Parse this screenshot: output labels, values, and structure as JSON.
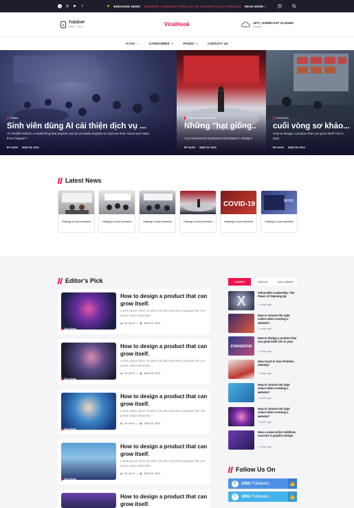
{
  "topbar": {
    "social": [
      "f",
      "◎",
      "▶",
      "t"
    ],
    "breaking_label": "BREAKING NEWS",
    "headline": "JENNIFER LAWRENCE TOPS LIST OF HIGHEST-PAID ACTRESSES",
    "read_more": "READ MORE ›"
  },
  "header": {
    "day": "TUESDAY",
    "date": "May 7, 2024",
    "cal_day": "5",
    "logo": "ViralHook",
    "weather_main": "10ºC, OVERCAST CLOUDS",
    "weather_loc": "Canada"
  },
  "nav": [
    {
      "label": "HOME"
    },
    {
      "label": "CATEGORIES"
    },
    {
      "label": "PAGES"
    },
    {
      "label": "CONTACT US"
    }
  ],
  "hero": [
    {
      "category": "Politics",
      "title": "Sinh viên dùng AI cải thiện dịch vụ ...",
      "excerpt": "Yo Reddit! What's a small thing that anyone can do at nearly anytime to improve their mood and make them happier?",
      "author": "BY ALEX",
      "date": "MAR 25, 2024"
    },
    {
      "category": "Russia and Ukraine War",
      "title": "Những \"hạt giống..",
      "excerpt": "Any mechanical keyboard enthusiasts in design?",
      "author": "BY ALEX",
      "date": "MAR 25, 2024"
    },
    {
      "category": "Viral News",
      "title": "cuối vòng sơ khảo...",
      "excerpt": "How to design a product that can grow itself 10x in year:",
      "author": "BY ALEX",
      "date": "MAR 25, 2024"
    }
  ],
  "latest": {
    "title": "Latest News",
    "items": [
      {
        "caption": "Helping a local business"
      },
      {
        "caption": "Helping a local business"
      },
      {
        "caption": "Helping a local business"
      },
      {
        "caption": "Helping a local business"
      },
      {
        "caption": "Helping a local business"
      },
      {
        "caption": "Helping a local business"
      }
    ],
    "covid_text": "COVID-19",
    "news_text": "NEWS"
  },
  "editors": {
    "title": "Editor’s Pick",
    "items": [
      {
        "title": "How to design a product that can grow itself.",
        "excerpt": "Lorem ipsum dolor sit amet, ad odio nonumes quaeque his, nec posse oratio dissentiet.",
        "author": "BY ALEX",
        "date": "MAR 25, 2024",
        "category": "Viral News"
      },
      {
        "title": "How to design a product that can grow itself.",
        "excerpt": "Lorem ipsum dolor sit amet, ad odio nonumes quaeque his, nec posse oratio dissentiet.",
        "author": "BY ALEX",
        "date": "MAR 25, 2024",
        "category": "Viral News"
      },
      {
        "title": "How to design a product that can grow itself.",
        "excerpt": "Lorem ipsum dolor sit amet, ad odio nonumes quaeque his, nec posse oratio dissentiet.",
        "author": "BY ALEX",
        "date": "MAR 25, 2024",
        "category": "Viral News"
      },
      {
        "title": "How to design a product that can grow itself.",
        "excerpt": "Lorem ipsum dolor sit amet, ad odio nonumes quaeque his, nec posse oratio dissentiet.",
        "author": "BY ALEX",
        "date": "MAR 25, 2024",
        "category": "Viral News"
      },
      {
        "title": "How to design a product that can grow itself.",
        "excerpt": "",
        "author": "",
        "date": "",
        "category": ""
      }
    ]
  },
  "sidebar": {
    "tabs": [
      "LATEST",
      "VIDEOS",
      "GALLERIES"
    ],
    "items": [
      {
        "title": "Vulnerable Leadership: The Power of Opening Up",
        "time": "1 month ago"
      },
      {
        "title": "How to choose the right colors when creating a website?",
        "time": "1 month ago"
      },
      {
        "title": "How to design a product that can grow itself 10x in year:",
        "time": "1 month ago"
      },
      {
        "title": "How Good Is Your Problem Solving?",
        "time": "1 month ago"
      },
      {
        "title": "How to choose the right colors when creating a website?",
        "time": "1 month ago"
      },
      {
        "title": "How to choose the right colors when creating a website?",
        "time": "1 month ago"
      },
      {
        "title": "How a visual artist redefines success in graphic design",
        "time": "1 month ago"
      }
    ],
    "thumb_words": {
      "x": "X",
      "stargrove": "STARGROVE"
    }
  },
  "follow": {
    "title": "Follow Us On",
    "items": [
      {
        "icon": "f",
        "count": "245k",
        "label": "Followers"
      },
      {
        "icon": "t",
        "count": "300k",
        "label": "Followers"
      }
    ]
  },
  "colors": {
    "accent": "#f0124b",
    "topbar": "#1d1d2b",
    "facebook": "#4f91e6"
  }
}
